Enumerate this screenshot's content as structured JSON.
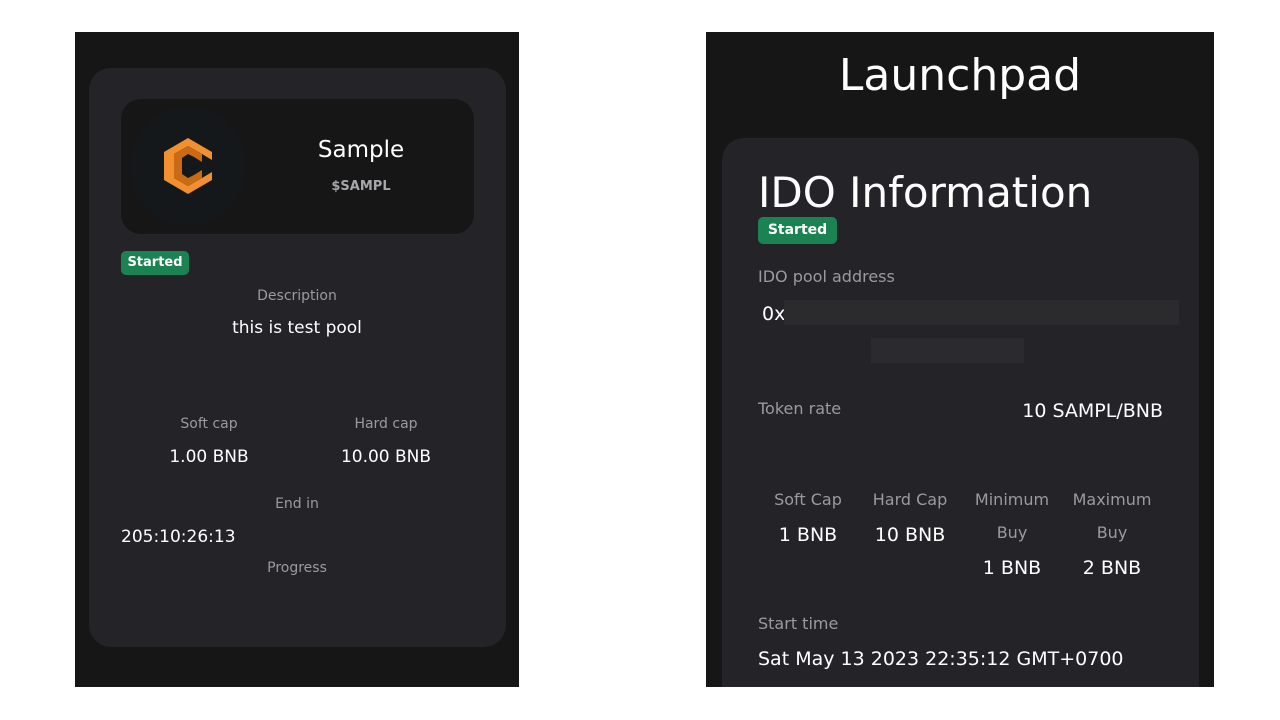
{
  "pool_card": {
    "token_name": "Sample",
    "token_symbol": "$SAMPL",
    "status": "Started",
    "description_label": "Description",
    "description": "this is test pool",
    "soft_cap_label": "Soft cap",
    "soft_cap": "1.00 BNB",
    "hard_cap_label": "Hard cap",
    "hard_cap": "10.00 BNB",
    "end_in_label": "End in",
    "end_in": "205:10:26:13",
    "progress_label": "Progress",
    "logo_icon": "token-logo-icon",
    "logo_color": "#f28f2e"
  },
  "launchpad": {
    "page_title": "Launchpad",
    "title": "IDO Information",
    "status": "Started",
    "pool_address_label": "IDO pool address",
    "pool_address_prefix": "0x",
    "token_rate_label": "Token rate",
    "token_rate": "10 SAMPL/BNB",
    "soft_cap_label": "Soft Cap",
    "soft_cap": "1 BNB",
    "hard_cap_label": "Hard Cap",
    "hard_cap": "10 BNB",
    "min_buy_label_1": "Minimum",
    "min_buy_label_2": "Buy",
    "min_buy": "1 BNB",
    "max_buy_label_1": "Maximum",
    "max_buy_label_2": "Buy",
    "max_buy": "2 BNB",
    "start_time_label": "Start time",
    "start_time": "Sat May 13 2023 22:35:12 GMT+0700"
  },
  "colors": {
    "panel_bg": "#161616",
    "card_bg": "#232328",
    "status_green": "#1b8352"
  }
}
